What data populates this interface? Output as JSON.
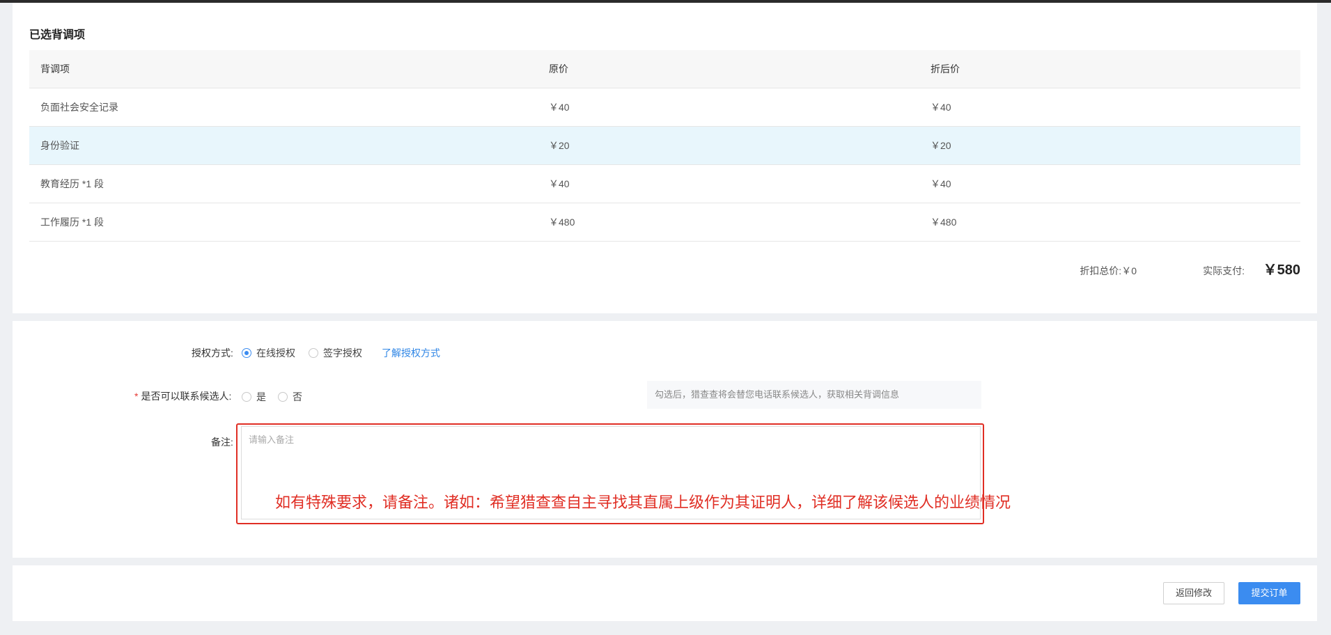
{
  "selected_items": {
    "title": "已选背调项",
    "columns": [
      "背调项",
      "原价",
      "折后价"
    ],
    "rows": [
      {
        "item": "负面社会安全记录",
        "price": "￥40",
        "discount_price": "￥40"
      },
      {
        "item": "身份验证",
        "price": "￥20",
        "discount_price": "￥20"
      },
      {
        "item": "教育经历 *1 段",
        "price": "￥40",
        "discount_price": "￥40"
      },
      {
        "item": "工作履历 *1 段",
        "price": "￥480",
        "discount_price": "￥480"
      }
    ],
    "discount_total_label": "折扣总价:",
    "discount_total_value": "￥0",
    "actual_pay_label": "实际支付:",
    "actual_pay_value": "￥580"
  },
  "form": {
    "auth_label": "授权方式:",
    "auth_options": [
      "在线授权",
      "签字授权"
    ],
    "auth_selected": "在线授权",
    "auth_link": "了解授权方式",
    "contact_required_mark": "*",
    "contact_label": "是否可以联系候选人:",
    "contact_options": [
      "是",
      "否"
    ],
    "contact_hint": "勾选后，猎查查将会替您电话联系候选人，获取相关背调信息",
    "remark_label": "备注:",
    "remark_placeholder": "请输入备注",
    "remark_value": "",
    "annotation_text": "如有特殊要求，请备注。诸如：希望猎查查自主寻找其直属上级作为其证明人，详细了解该候选人的业绩情况"
  },
  "footer": {
    "back_label": "返回修改",
    "submit_label": "提交订单"
  },
  "colors": {
    "accent": "#3b8cf0",
    "annotation_red": "#e02e24",
    "row_highlight": "#e8f6fc"
  }
}
